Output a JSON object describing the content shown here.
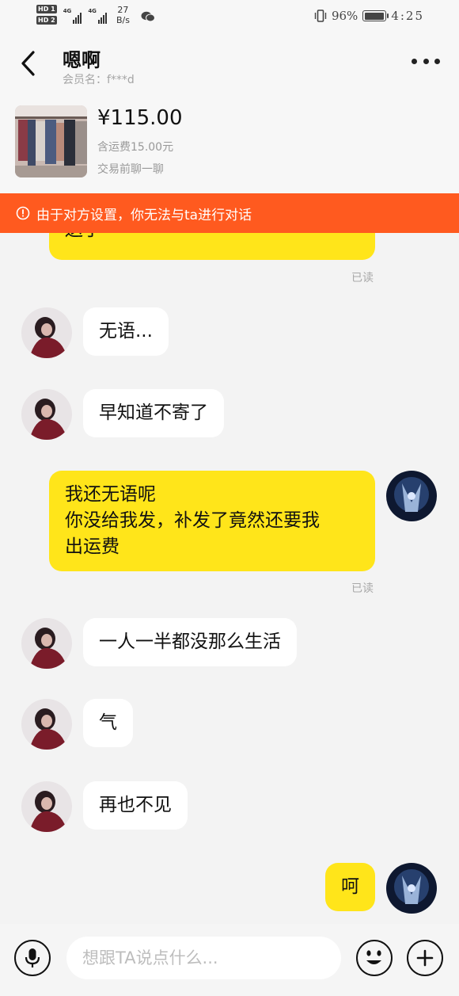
{
  "status_bar": {
    "hd1": "HD 1",
    "hd2": "HD 2",
    "net1": "4G",
    "net2": "4G",
    "speed_value": "27",
    "speed_unit": "B/s",
    "battery": "96%",
    "time": "4:25",
    "icons": [
      "signal-icon",
      "wechat-icon",
      "vibrate-icon",
      "battery-icon"
    ]
  },
  "header": {
    "title": "嗯啊",
    "member_label": "会员名：f***d",
    "icons": [
      "back-icon",
      "more-icon"
    ]
  },
  "product": {
    "price": "¥115.00",
    "shipping": "含运费15.00元",
    "tip": "交易前聊一聊"
  },
  "warning": {
    "text": "由于对方设置，你无法与ta进行对话",
    "icon": "warning-circle-icon"
  },
  "messages": [
    {
      "side": "out",
      "lines": [
        "送了"
      ],
      "read": "已读"
    },
    {
      "side": "in",
      "lines": [
        "无语..."
      ]
    },
    {
      "side": "in",
      "lines": [
        "早知道不寄了"
      ]
    },
    {
      "side": "out",
      "lines": [
        "我还无语呢",
        "你没给我发，补发了竟然还要我",
        "出运费"
      ],
      "read": "已读"
    },
    {
      "side": "in",
      "lines": [
        "一人一半都没那么生活"
      ]
    },
    {
      "side": "in",
      "lines": [
        "气"
      ]
    },
    {
      "side": "in",
      "lines": [
        "再也不见"
      ]
    },
    {
      "side": "out",
      "lines": [
        "呵"
      ]
    }
  ],
  "input": {
    "placeholder": "想跟TA说点什么..."
  },
  "bottom_icons": [
    "mic-icon",
    "emoji-icon",
    "plus-icon"
  ],
  "colors": {
    "warning_bg": "#ff5a1f",
    "outgoing_bubble": "#ffe51a",
    "incoming_bubble": "#ffffff"
  }
}
